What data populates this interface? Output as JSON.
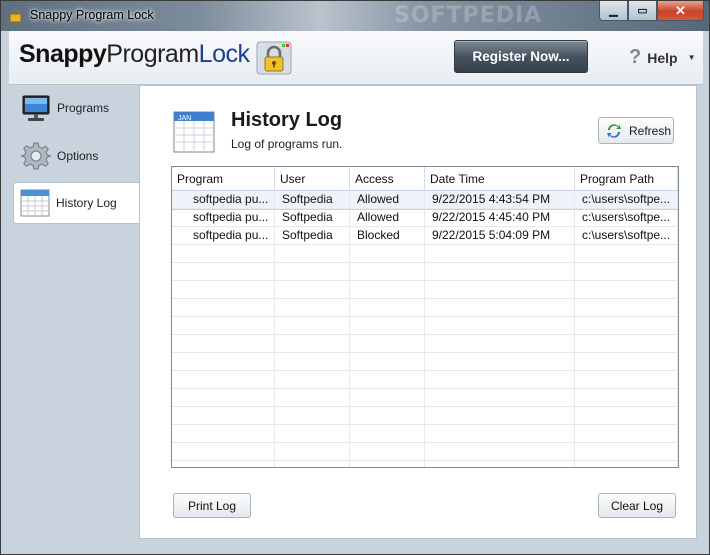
{
  "window": {
    "title": "Snappy Program Lock",
    "watermark": "SOFTPEDIA"
  },
  "header": {
    "logo_part1": "Snappy",
    "logo_part2": "Program",
    "logo_part3": "Lock",
    "register_label": "Register Now...",
    "help_label": "Help",
    "help_icon": "?"
  },
  "sidebar": {
    "items": [
      {
        "label": "Programs",
        "icon": "monitor-icon"
      },
      {
        "label": "Options",
        "icon": "gear-icon"
      },
      {
        "label": "History Log",
        "icon": "calendar-icon",
        "active": true
      }
    ]
  },
  "main": {
    "title": "History Log",
    "subtitle": "Log of programs run.",
    "calendar_label": "JAN",
    "refresh_label": "Refresh",
    "print_label": "Print Log",
    "clear_label": "Clear Log"
  },
  "table": {
    "columns": [
      "Program",
      "User",
      "Access",
      "Date Time",
      "Program Path"
    ],
    "rows": [
      [
        "softpedia pu...",
        "Softpedia",
        "Allowed",
        "9/22/2015 4:43:54 PM",
        "c:\\users\\softpe..."
      ],
      [
        "softpedia pu...",
        "Softpedia",
        "Allowed",
        "9/22/2015 4:45:40 PM",
        "c:\\users\\softpe..."
      ],
      [
        "softpedia pu...",
        "Softpedia",
        "Blocked",
        "9/22/2015 5:04:09 PM",
        "c:\\users\\softpe..."
      ]
    ]
  },
  "colors": {
    "accent": "#1f3f93",
    "titlebar": "#6b7b8c",
    "close": "#c7432a"
  }
}
